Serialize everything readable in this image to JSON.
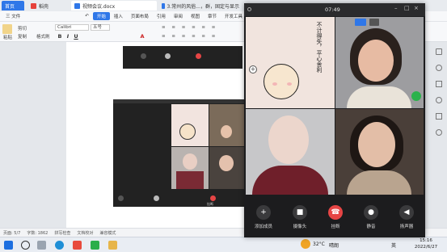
{
  "tabs": [
    {
      "label": "首页",
      "icon": "home-icon"
    },
    {
      "label": "稻壳",
      "icon": "docer-icon"
    },
    {
      "label": "视频会议.docx",
      "icon": "doc-icon"
    },
    {
      "label": "3.常州的风俗...，群，固定与显示",
      "icon": "doc-icon"
    }
  ],
  "menu": {
    "file": "三 文件",
    "items": [
      "开始",
      "插入",
      "页面布局",
      "引用",
      "审阅",
      "视图",
      "章节",
      "开发工具"
    ]
  },
  "toolbar": {
    "paste": "粘贴",
    "cut": "剪切",
    "copy": "复制",
    "format_painter": "格式刷",
    "font": "Calibri",
    "size": "五号",
    "bold": "B",
    "italic": "I",
    "underline": "U",
    "font_color": "A"
  },
  "mini_call": {
    "hangup_label": "挂断"
  },
  "status": {
    "page": "页面: 5/7",
    "words": "字数: 1862",
    "spell": "拼写检查",
    "proof": "文档校对",
    "compat": "兼容模式"
  },
  "taskbar": {
    "temp": "32°C",
    "weather": "晴朗",
    "lang": "英",
    "time": "15:16",
    "date": "2022/6/27"
  },
  "call": {
    "time": "07:49",
    "calligraphy": "不计得失，平心舍利",
    "buttons": [
      {
        "label": "添加成员",
        "icon": "plus-icon"
      },
      {
        "label": "摄像头",
        "icon": "camera-icon"
      },
      {
        "label": "挂断",
        "icon": "hangup-icon"
      },
      {
        "label": "静音",
        "icon": "mic-off-icon"
      },
      {
        "label": "扬声器",
        "icon": "speaker-icon"
      }
    ]
  },
  "colors": {
    "accent": "#2f77e8",
    "hangup": "#e64545",
    "call_bg": "#1c1c1e"
  }
}
